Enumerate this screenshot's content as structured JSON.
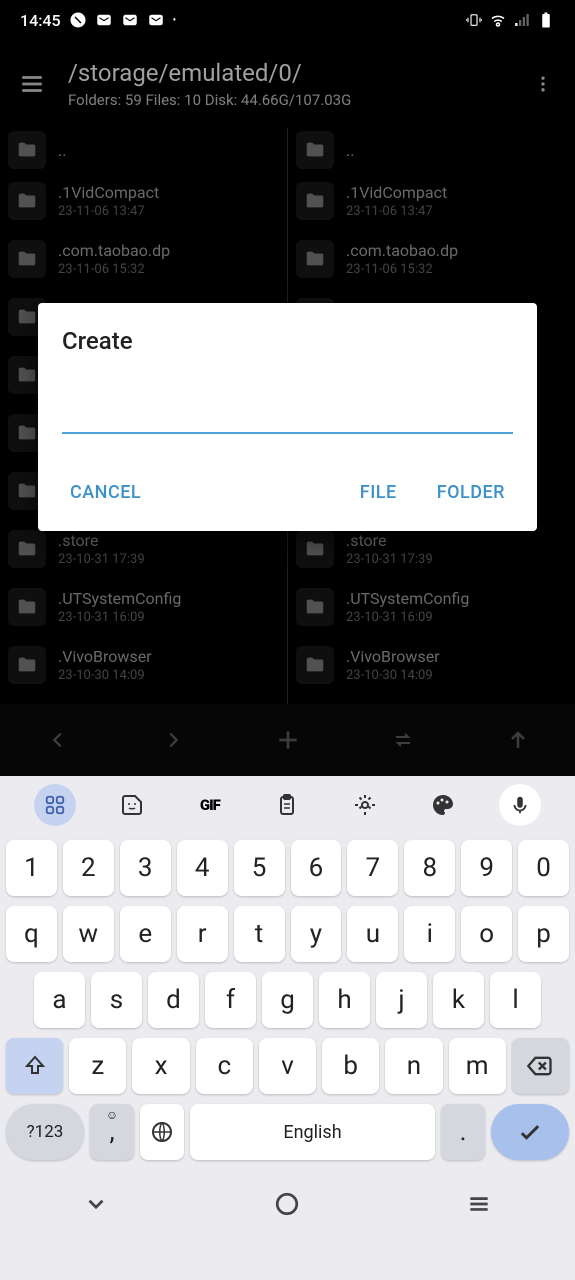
{
  "status": {
    "time": "14:45"
  },
  "header": {
    "path": "/storage/emulated/0/",
    "stats": "Folders: 59  Files: 10  Disk: 44.66G/107.03G"
  },
  "files": [
    {
      "name": "..",
      "date": ""
    },
    {
      "name": ".1VidCompact",
      "date": "23-11-06 13:47"
    },
    {
      "name": ".com.taobao.dp",
      "date": "23-11-06 15:32"
    },
    {
      "name": "",
      "date": ""
    },
    {
      "name": "",
      "date": ""
    },
    {
      "name": "",
      "date": ""
    },
    {
      "name": "",
      "date": ""
    },
    {
      "name": ".store",
      "date": "23-10-31 17:39"
    },
    {
      "name": ".UTSystemConfig",
      "date": "23-10-31 16:09"
    },
    {
      "name": ".VivoBrowser",
      "date": "23-10-30 14:09"
    }
  ],
  "dialog": {
    "title": "Create",
    "cancel": "CANCEL",
    "file": "FILE",
    "folder": "FOLDER",
    "value": ""
  },
  "keyboard": {
    "rows": [
      [
        "1",
        "2",
        "3",
        "4",
        "5",
        "6",
        "7",
        "8",
        "9",
        "0"
      ],
      [
        "q",
        "w",
        "e",
        "r",
        "t",
        "y",
        "u",
        "i",
        "o",
        "p"
      ],
      [
        "a",
        "s",
        "d",
        "f",
        "g",
        "h",
        "j",
        "k",
        "l"
      ],
      [
        "z",
        "x",
        "c",
        "v",
        "b",
        "n",
        "m"
      ]
    ],
    "num": "?123",
    "space": "English",
    "comma": ",",
    "dot": "."
  }
}
